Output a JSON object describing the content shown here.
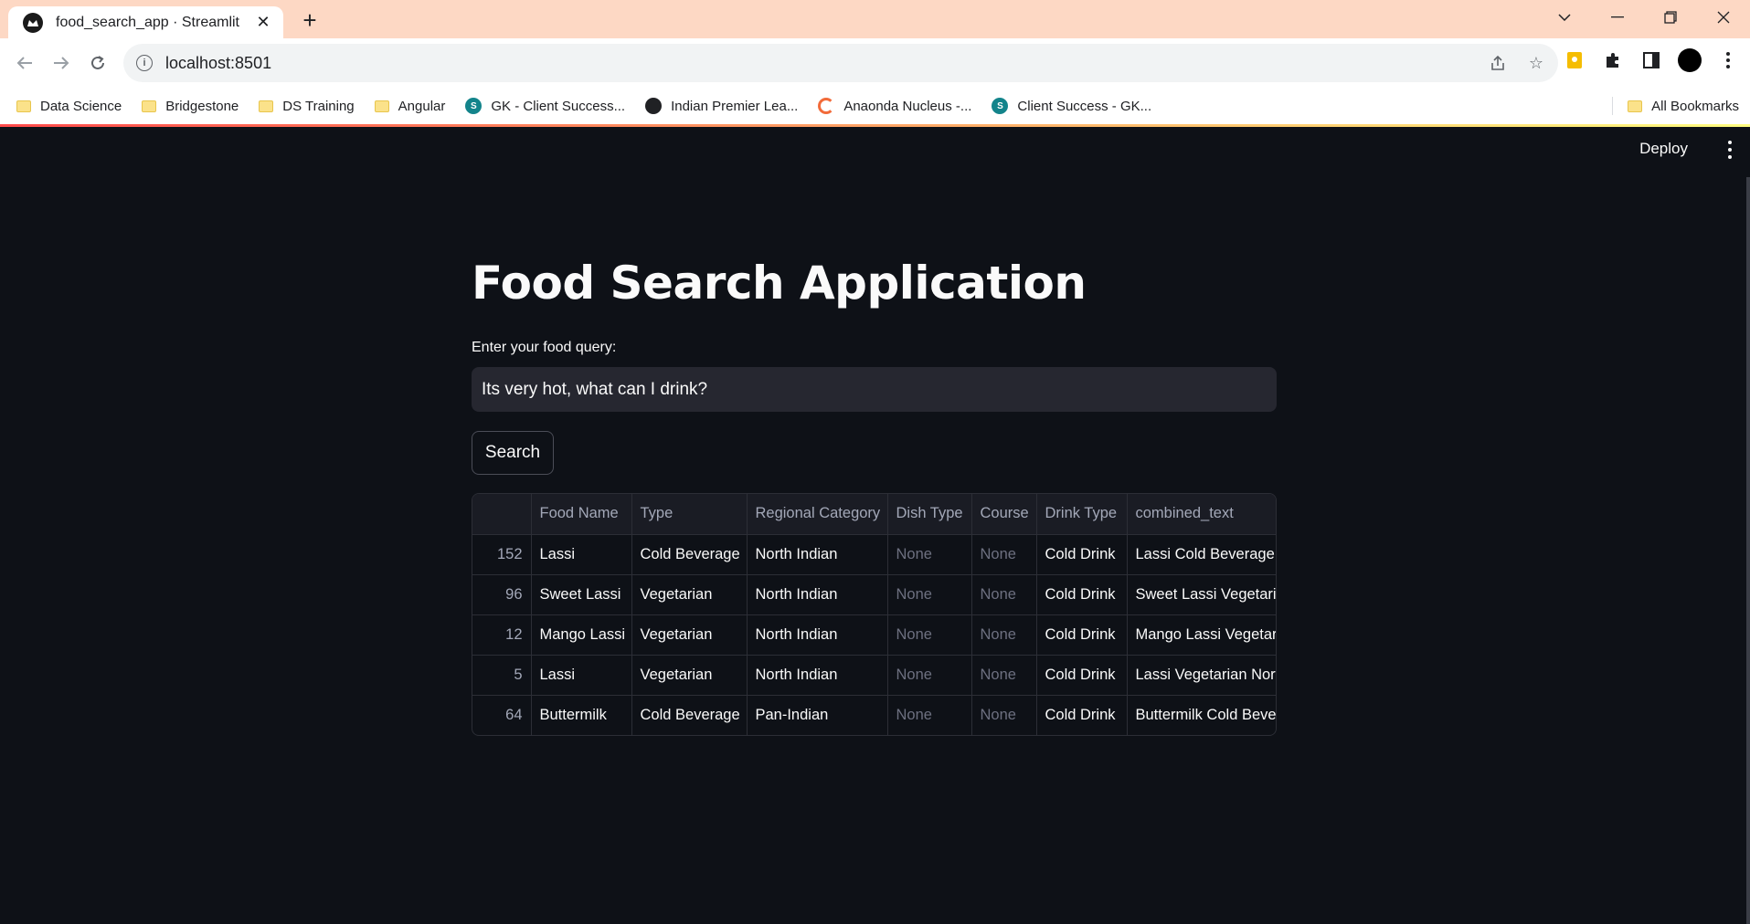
{
  "browser": {
    "tab_title": "food_search_app · Streamlit",
    "url": "localhost:8501",
    "bookmarks": [
      {
        "label": "Data Science",
        "icon": "folder-icon"
      },
      {
        "label": "Bridgestone",
        "icon": "folder-icon"
      },
      {
        "label": "DS Training",
        "icon": "folder-icon"
      },
      {
        "label": "Angular",
        "icon": "folder-icon"
      },
      {
        "label": "GK - Client Success...",
        "icon": "sharepoint-icon"
      },
      {
        "label": "Indian Premier Lea...",
        "icon": "globe-icon"
      },
      {
        "label": "Anaonda Nucleus -...",
        "icon": "anaconda-icon"
      },
      {
        "label": "Client Success - GK...",
        "icon": "sharepoint-icon"
      }
    ],
    "all_bookmarks": "All Bookmarks"
  },
  "app": {
    "deploy_label": "Deploy",
    "title": "Food Search Application",
    "query_label": "Enter your food query:",
    "query_value": "Its very hot, what can I drink?",
    "search_label": "Search",
    "table": {
      "columns": [
        "",
        "Food Name",
        "Type",
        "Regional Category",
        "Dish Type",
        "Course",
        "Drink Type",
        "combined_text"
      ],
      "rows": [
        [
          "152",
          "Lassi",
          "Cold Beverage",
          "North Indian",
          "None",
          "None",
          "Cold Drink",
          "Lassi Cold Beverage N"
        ],
        [
          "96",
          "Sweet Lassi",
          "Vegetarian",
          "North Indian",
          "None",
          "None",
          "Cold Drink",
          "Sweet Lassi Vegetaria"
        ],
        [
          "12",
          "Mango Lassi",
          "Vegetarian",
          "North Indian",
          "None",
          "None",
          "Cold Drink",
          "Mango Lassi Vegetari"
        ],
        [
          "5",
          "Lassi",
          "Vegetarian",
          "North Indian",
          "None",
          "None",
          "Cold Drink",
          "Lassi Vegetarian Nort"
        ],
        [
          "64",
          "Buttermilk",
          "Cold Beverage",
          "Pan-Indian",
          "None",
          "None",
          "Cold Drink",
          "Buttermilk Cold Beve"
        ]
      ]
    }
  },
  "colors": {
    "app_bg": "#0e1117",
    "input_bg": "#262730",
    "tab_strip": "#fdd8c4",
    "accent_gradient_start": "#ff4b4b",
    "accent_gradient_end": "#fffd80"
  }
}
